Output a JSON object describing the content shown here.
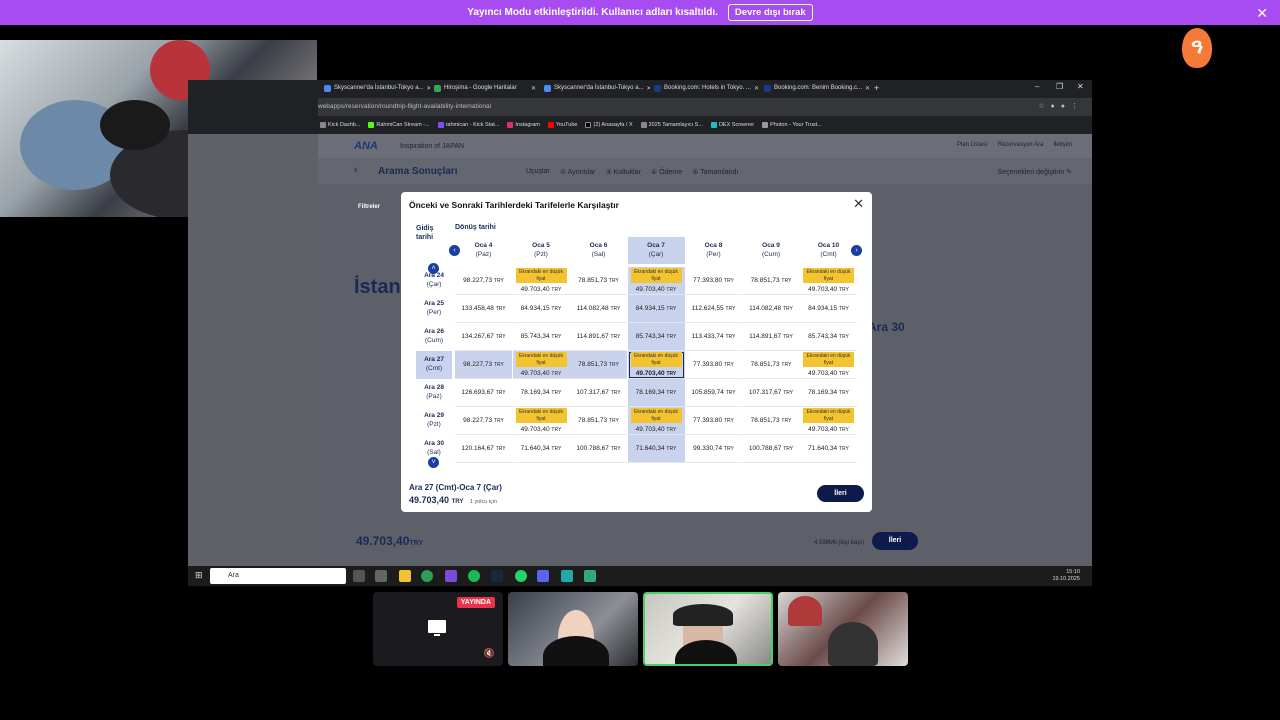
{
  "banner": {
    "text": "Yayıncı Modu etkinleştirildi. Kullanıcı adları kısaltıldı.",
    "button": "Devre dışı bırak",
    "close": "✕"
  },
  "app_logo": "ዓ",
  "browser": {
    "tabs": [
      {
        "label": "Skyscanner'da İstanbul-Tokyo a...",
        "icon": "skyscanner-icon"
      },
      {
        "label": "Hiroşima - Google Haritalar",
        "icon": "google-maps-icon"
      },
      {
        "label": "Skyscanner'da İstanbul-Tokyo a...",
        "icon": "skyscanner-icon"
      },
      {
        "label": "Booking.com: Hotels in Tokyo. ...",
        "icon": "booking-icon"
      },
      {
        "label": "Booking.com: Benim Booking.c...",
        "icon": "booking-icon"
      }
    ],
    "new_tab": "+",
    "window_controls": [
      "–",
      "❐",
      "✕"
    ],
    "address": "webapps/reservation/roundtrip-flight-availability-international",
    "bookmarks": [
      "Kick Dashb...",
      "RahmiCan Stream -...",
      "rahmican - Kick Stat...",
      "Instagram",
      "YouTube",
      "(2) Anasayfa / X",
      "2025 Tamamlayıcı S...",
      "DEX Screener",
      "Photon - Your Trust..."
    ]
  },
  "ana": {
    "logo": "ANA",
    "tagline": "Inspiration of JAPAN",
    "nav": [
      "Plan Listesi",
      "Rezervasyon Ara",
      "İletişim"
    ],
    "title": "Arama Sonuçları",
    "steps": [
      "Uçuşlar",
      "② Ayrıntılar",
      "③ Koltuklar",
      "④ Ödeme",
      "⑤ Tamamlandı"
    ],
    "change": "Seçenekleri değiştirin ✎",
    "filters": "Filtreler",
    "bg_title": "İstanb",
    "bg_ara30": "Ara 30",
    "bottom_price": "49.703,40",
    "bottom_price_cur": "TRY",
    "bottom_miles": "4.598Mil (kişi başı)",
    "bottom_next": "İleri"
  },
  "taskbar": {
    "search": "Ara",
    "time": "15:10",
    "date": "19.10.2025"
  },
  "modal": {
    "title": "Önceki ve Sonraki Tarihlerdeki Tarifelerle Karşılaştır",
    "close": "✕",
    "outbound_label": "Gidiş tarihi",
    "return_label": "Dönüş tarihi",
    "badge_text": "Ekrandaki en düşük fiyat",
    "currency": "TRY",
    "columns": [
      {
        "date": "Oca 4",
        "day": "(Paz)"
      },
      {
        "date": "Oca 5",
        "day": "(Pzt)"
      },
      {
        "date": "Oca 6",
        "day": "(Sal)"
      },
      {
        "date": "Oca 7",
        "day": "(Çar)"
      },
      {
        "date": "Oca 8",
        "day": "(Per)"
      },
      {
        "date": "Oca 9",
        "day": "(Cum)"
      },
      {
        "date": "Oca 10",
        "day": "(Cmt)"
      }
    ],
    "rows": [
      {
        "date": "Ara 24",
        "day": "(Çar)"
      },
      {
        "date": "Ara 25",
        "day": "(Per)"
      },
      {
        "date": "Ara 26",
        "day": "(Cum)"
      },
      {
        "date": "Ara 27",
        "day": "(Cmt)"
      },
      {
        "date": "Ara 28",
        "day": "(Paz)"
      },
      {
        "date": "Ara 29",
        "day": "(Pzt)"
      },
      {
        "date": "Ara 30",
        "day": "(Sal)"
      }
    ],
    "prices": [
      [
        "98.227,73",
        "49.703,40",
        "78.851,73",
        "49.703,40",
        "77.393,80",
        "78.851,73",
        "49.703,40"
      ],
      [
        "133.458,48",
        "84.934,15",
        "114.082,48",
        "84.934,15",
        "112.624,55",
        "114.082,48",
        "84.934,15"
      ],
      [
        "134.267,67",
        "85.743,34",
        "114.891,67",
        "85.743,34",
        "113.433,74",
        "114.891,67",
        "85.743,34"
      ],
      [
        "98.227,73",
        "49.703,40",
        "78.851,73",
        "49.703,40",
        "77.393,80",
        "78.851,73",
        "49.703,40"
      ],
      [
        "126.693,67",
        "78.169,34",
        "107.317,67",
        "78.169,34",
        "105.859,74",
        "107.317,67",
        "78.169,34"
      ],
      [
        "98.227,73",
        "49.703,40",
        "78.851,73",
        "49.703,40",
        "77.393,80",
        "78.851,73",
        "49.703,40"
      ],
      [
        "120.164,67",
        "71.640,34",
        "100.788,67",
        "71.640,34",
        "99.330,74",
        "100.788,67",
        "71.640,34"
      ]
    ],
    "lowest_cols": [
      1,
      3,
      6
    ],
    "lowest_rows": [
      0,
      3,
      5
    ],
    "selected_row": 3,
    "selected_col": 3,
    "footer_route": "Ara 27 (Cmt)-Oca 7 (Çar)",
    "footer_price": "49.703,40",
    "footer_pax": "1 yolcu için",
    "footer_next": "İleri"
  },
  "call": {
    "live": "YAYINDA"
  },
  "colors": {
    "banner": "#a64cf0",
    "accent": "#1b3fa0",
    "badge": "#f4c430",
    "selection": "#c9d3ee",
    "navy": "#0d1a4a"
  }
}
